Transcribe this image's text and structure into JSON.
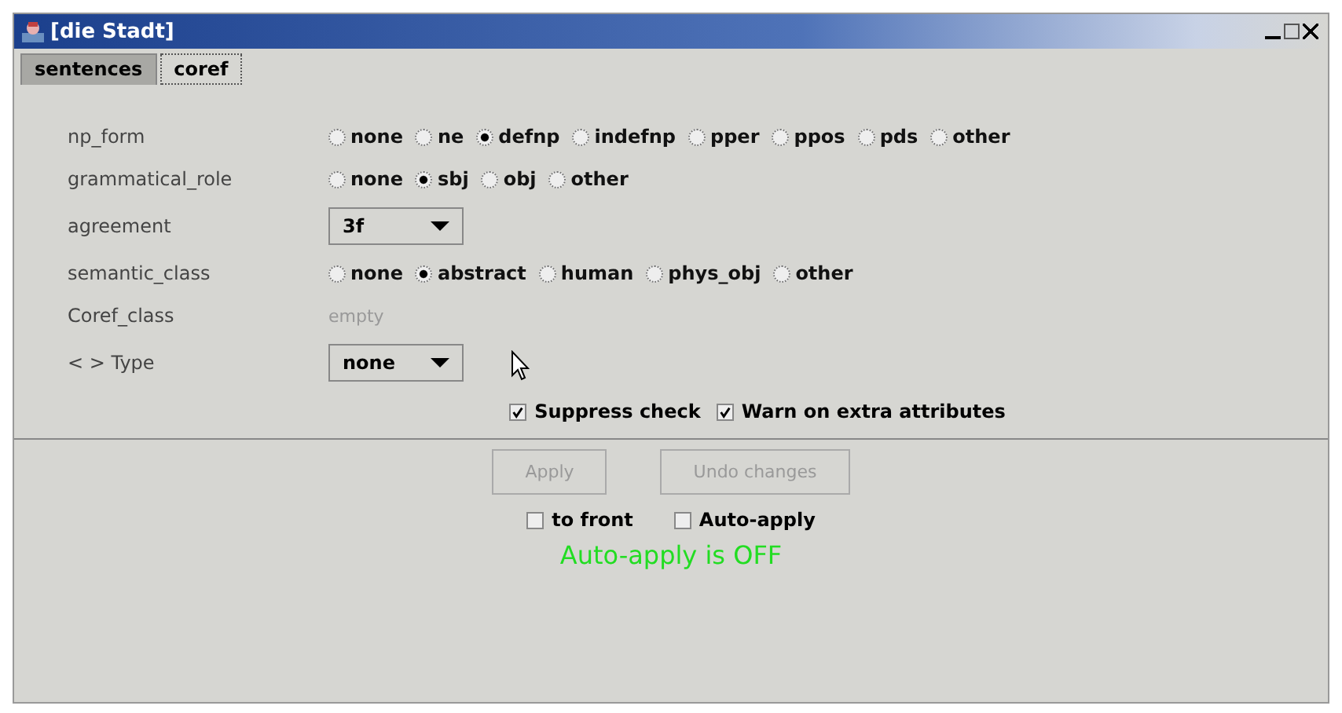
{
  "window": {
    "title": "[die Stadt]"
  },
  "tabs": [
    {
      "label": "sentences",
      "selected": false
    },
    {
      "label": "coref",
      "selected": true
    }
  ],
  "fields": [
    {
      "kind": "radio",
      "label": "np_form",
      "options": [
        {
          "label": "none",
          "selected": false
        },
        {
          "label": "ne",
          "selected": false
        },
        {
          "label": "defnp",
          "selected": true
        },
        {
          "label": "indefnp",
          "selected": false
        },
        {
          "label": "pper",
          "selected": false
        },
        {
          "label": "ppos",
          "selected": false
        },
        {
          "label": "pds",
          "selected": false
        },
        {
          "label": "other",
          "selected": false
        }
      ]
    },
    {
      "kind": "radio",
      "label": "grammatical_role",
      "options": [
        {
          "label": "none",
          "selected": false
        },
        {
          "label": "sbj",
          "selected": true
        },
        {
          "label": "obj",
          "selected": false
        },
        {
          "label": "other",
          "selected": false
        }
      ]
    },
    {
      "kind": "select",
      "label": "agreement",
      "value": "3f"
    },
    {
      "kind": "radio",
      "label": "semantic_class",
      "options": [
        {
          "label": "none",
          "selected": false
        },
        {
          "label": "abstract",
          "selected": true
        },
        {
          "label": "human",
          "selected": false
        },
        {
          "label": "phys_obj",
          "selected": false
        },
        {
          "label": "other",
          "selected": false
        }
      ]
    },
    {
      "kind": "text",
      "label": "Coref_class",
      "value": "empty"
    },
    {
      "kind": "select",
      "label": "< > Type",
      "value": "none"
    }
  ],
  "options": [
    {
      "label": "Suppress check",
      "checked": true
    },
    {
      "label": "Warn on extra attributes",
      "checked": true
    }
  ],
  "buttons": [
    {
      "label": "Apply",
      "disabled": true
    },
    {
      "label": "Undo changes",
      "disabled": true
    }
  ],
  "toggles": [
    {
      "label": "to front",
      "checked": false
    },
    {
      "label": "Auto-apply",
      "checked": false
    }
  ],
  "status": "Auto-apply is OFF"
}
